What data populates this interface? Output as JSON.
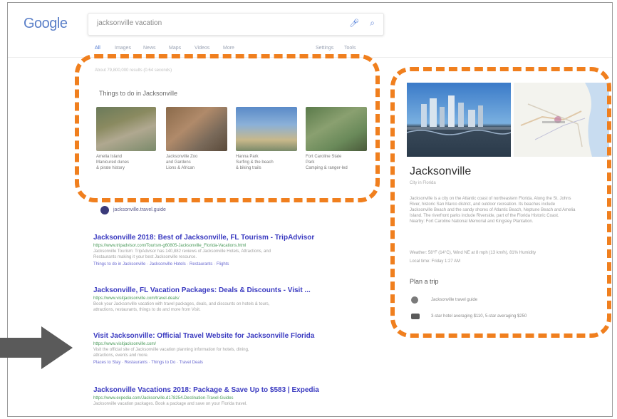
{
  "logo": "Google",
  "search": {
    "query": "jacksonville vacation",
    "mic_icon": "microphone-icon",
    "search_icon": "search-icon"
  },
  "tabs": {
    "items": [
      "All",
      "Images",
      "News",
      "Maps",
      "Videos",
      "More",
      "Settings",
      "Tools"
    ],
    "active": "All"
  },
  "stats": "About 79,800,000 results (0.64 seconds)",
  "things_to_do": {
    "title": "Things to do in Jacksonville",
    "cards": [
      {
        "name": "Amelia Island",
        "desc1": "Manicured dunes",
        "desc2": "& pirate history"
      },
      {
        "name": "Jacksonville Zoo",
        "desc1": "and Gardens",
        "desc2": "Lions & African"
      },
      {
        "name": "Hanna Park",
        "desc1": "Surfing & the beach",
        "desc2": "& biking trails"
      },
      {
        "name": "Fort Caroline State",
        "desc1": "Park",
        "desc2": "Camping & ranger-led"
      }
    ]
  },
  "favicon_link": "jacksonville.travel.guide",
  "results": [
    {
      "title": "Jacksonville 2018: Best of Jacksonville, FL Tourism - TripAdvisor",
      "url": "https://www.tripadvisor.com/Tourism-g60805-Jacksonville_Florida-Vacations.html",
      "lines": [
        "Jacksonville Tourism: TripAdvisor has 140,882 reviews of Jacksonville Hotels, Attractions, and",
        "Restaurants making it your best Jacksonville resource."
      ],
      "links": "Things to do in Jacksonville · Jacksonville Hotels · Restaurants · Flights"
    },
    {
      "title": "Jacksonville, FL Vacation Packages: Deals & Discounts - Visit ...",
      "url": "https://www.visitjacksonville.com/travel-deals/",
      "lines": [
        "Book your Jacksonville vacation with travel packages, deals, and discounts on hotels & tours,",
        "attractions, restaurants, things to do and more from Visit."
      ]
    },
    {
      "title": "Visit Jacksonville: Official Travel Website for Jacksonville Florida",
      "url": "https://www.visitjacksonville.com/",
      "lines": [
        "Visit the official site of Jacksonville vacation planning information for hotels, dining,",
        "attractions, events and more."
      ],
      "links": "Places to Stay · Restaurants · Things to Do · Travel Deals"
    },
    {
      "title": "Jacksonville Vacations 2018: Package & Save Up to $583 | Expedia",
      "url": "https://www.expedia.com/Jacksonville.d178254.Destination-Travel-Guides",
      "lines": [
        "Jacksonville vacation packages. Book a package and save on your Florida travel."
      ]
    }
  ],
  "knowledge_panel": {
    "name": "Jacksonville",
    "subtitle": "City in Florida",
    "description": [
      "Jacksonville is a city on the Atlantic coast of northeastern Florida. Along the St. Johns",
      "River, historic San Marco district, and outdoor recreation. Its beaches include",
      "Jacksonville Beach and the sandy shores of Atlantic Beach, Neptune Beach and Amelia",
      "Island. The riverfront parks include Riverside, part of the Florida Historic Coast.",
      "Nearby: Fort Caroline National Memorial and Kingsley Plantation."
    ],
    "weather": "Weather: 58°F (14°C), Wind NE at 8 mph (13 km/h), 81% Humidity",
    "local_time": "Local time: Friday 1:27 AM",
    "plan_title": "Plan a trip",
    "plan_items": [
      {
        "icon": "globe-icon",
        "text": "Jacksonville travel guide"
      },
      {
        "icon": "hotel-icon",
        "text": "3-star hotel averaging $110, 5-star averaging $250"
      }
    ]
  },
  "colors": {
    "highlight": "#f07f1e",
    "arrow": "#5a5a5a",
    "link": "#3a3ac0"
  }
}
